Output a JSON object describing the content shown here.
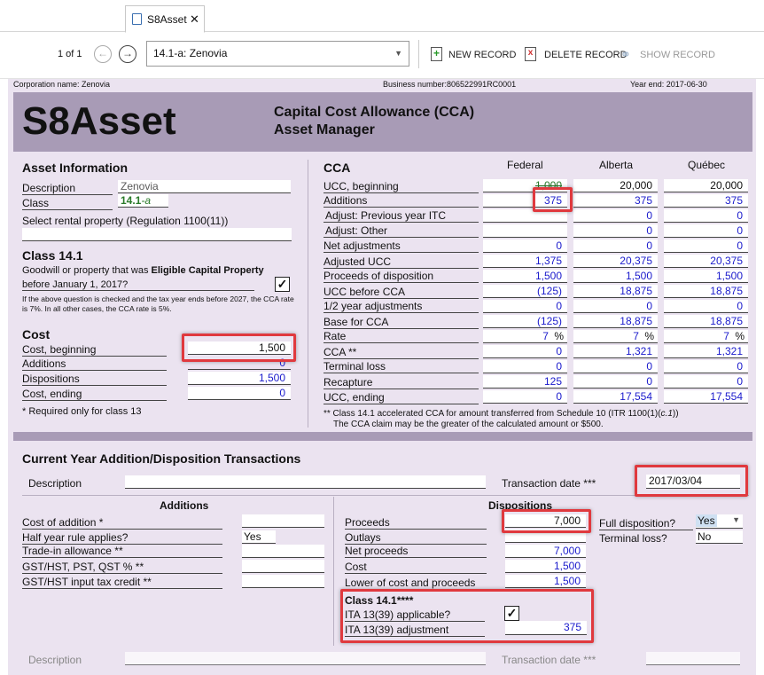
{
  "tab": {
    "title": "S8Asset"
  },
  "toolbar": {
    "record_count": "1 of 1",
    "record_value": "14.1-a: Zenovia",
    "new_record": "NEW RECORD",
    "delete_record": "DELETE RECORD",
    "show_record": "SHOW RECORD"
  },
  "header": {
    "corporation": "Corporation name: Zenovia",
    "business_number": "Business number:806522991RC0001",
    "year_end": "Year end: 2017-06-30",
    "form_title": "S8Asset",
    "subtitle1": "Capital Cost Allowance (CCA)",
    "subtitle2": "Asset Manager"
  },
  "asset": {
    "heading": "Asset Information",
    "description_label": "Description",
    "description_value": "Zenovia",
    "class_label": "Class",
    "class_value": "14.1",
    "class_suffix": "-a",
    "rental_label": "Select rental property (Regulation 1100(11))"
  },
  "class141": {
    "heading": "Class 14.1",
    "text1": "Goodwill or property that was ",
    "text1_bold": "Eligible Capital Property",
    "text2": "before January 1, 2017?",
    "checkmark": "✓",
    "note": "If the above question is checked and the tax year ends before 2027, the CCA rate is 7%. In all other cases, the CCA rate is 5%."
  },
  "cost": {
    "heading": "Cost",
    "rows": [
      {
        "label": "Cost, beginning",
        "value": "1,500"
      },
      {
        "label": "Additions",
        "value": "0"
      },
      {
        "label": "Dispositions",
        "value": "1,500"
      },
      {
        "label": "Cost, ending",
        "value": "0"
      }
    ],
    "footnote": "* Required only for class 13"
  },
  "cca": {
    "heading": "CCA",
    "columns": [
      "Federal",
      "Alberta",
      "Québec"
    ],
    "rows": [
      {
        "label": "UCC, beginning",
        "values": [
          "1,000",
          "20,000",
          "20,000"
        ]
      },
      {
        "label": "Additions",
        "values": [
          "375",
          "375",
          "375"
        ]
      },
      {
        "label": "Adjust: Previous year ITC",
        "values": [
          "",
          "0",
          "0"
        ]
      },
      {
        "label": "Adjust: Other",
        "values": [
          "",
          "0",
          "0"
        ]
      },
      {
        "label": "Net adjustments",
        "values": [
          "0",
          "0",
          "0"
        ]
      },
      {
        "label": "Adjusted UCC",
        "values": [
          "1,375",
          "20,375",
          "20,375"
        ]
      },
      {
        "label": "Proceeds of disposition",
        "values": [
          "1,500",
          "1,500",
          "1,500"
        ]
      },
      {
        "label": "UCC before CCA",
        "values": [
          "(125)",
          "18,875",
          "18,875"
        ]
      },
      {
        "label": "1/2 year adjustments",
        "values": [
          "0",
          "0",
          "0"
        ]
      },
      {
        "label": "Base for CCA",
        "values": [
          "(125)",
          "18,875",
          "18,875"
        ]
      },
      {
        "label": "Rate",
        "values": [
          "7",
          "7",
          "7"
        ]
      },
      {
        "label": "CCA **",
        "values": [
          "0",
          "1,321",
          "1,321"
        ]
      },
      {
        "label": "Terminal loss",
        "values": [
          "0",
          "0",
          "0"
        ]
      },
      {
        "label": "Recapture",
        "values": [
          "125",
          "0",
          "0"
        ]
      },
      {
        "label": "UCC, ending",
        "values": [
          "0",
          "17,554",
          "17,554"
        ]
      }
    ],
    "percent": "%",
    "footnote1": "** Class 14.1 accelerated CCA for amount transferred from Schedule 10 (ITR 1100(1)(",
    "footnote1_italic": "c.1",
    "footnote1_end": "))",
    "footnote2": "The CCA claim may be the greater of the calculated amount or $500."
  },
  "transactions": {
    "heading": "Current Year Addition/Disposition Transactions",
    "description_label": "Description",
    "date_label": "Transaction date ***",
    "date_value": "2017/03/04",
    "additions_heading": "Additions",
    "dispositions_heading": "Dispositions",
    "additions": [
      {
        "label": "Cost of addition *",
        "value": ""
      },
      {
        "label": "Half year rule applies?",
        "value": "Yes"
      },
      {
        "label": "Trade-in allowance **",
        "value": ""
      },
      {
        "label": "GST/HST, PST, QST % **",
        "value": ""
      },
      {
        "label": "GST/HST input tax credit **",
        "value": ""
      }
    ],
    "dispositions": [
      {
        "label": "Proceeds",
        "value": "7,000"
      },
      {
        "label": "Outlays",
        "value": ""
      },
      {
        "label": "Net proceeds",
        "value": "7,000"
      },
      {
        "label": "Cost",
        "value": "1,500"
      },
      {
        "label": "Lower of cost and proceeds",
        "value": "1,500"
      }
    ],
    "full_disposition_label": "Full disposition?",
    "full_disposition_value": "Yes",
    "terminal_loss_label": "Terminal loss?",
    "terminal_loss_value": "No",
    "class141_heading": "Class 14.1****",
    "ita_applicable_label": "ITA 13(39) applicable?",
    "ita_checkmark": "✓",
    "ita_adjustment_label": "ITA 13(39) adjustment",
    "ita_adjustment_value": "375",
    "next_description_label": "Description",
    "next_date_label": "Transaction date ***"
  }
}
